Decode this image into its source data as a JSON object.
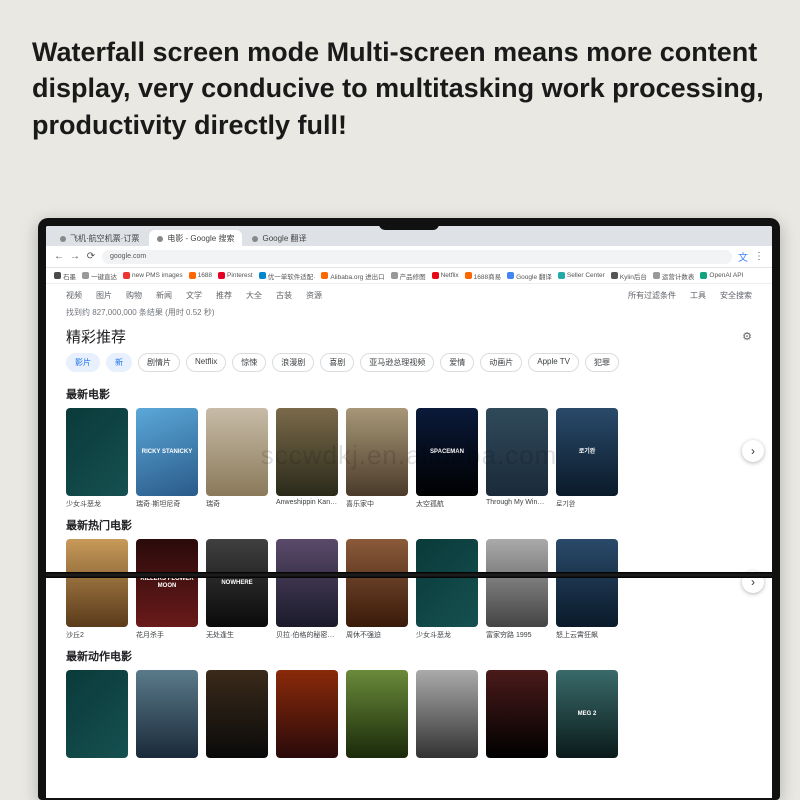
{
  "hero": "Waterfall screen mode Multi-screen means more content display, very conducive to multitasking work processing, productivity directly full!",
  "watermark": "sccwdkj.en.alibaba.com",
  "tabs": [
    {
      "label": "飞机·航空机票·订票",
      "active": false
    },
    {
      "label": "电影 - Google 搜索",
      "active": true
    },
    {
      "label": "Google 翻译",
      "active": false
    }
  ],
  "url": "google.com",
  "bookmarks": [
    {
      "label": "石墨",
      "color": "#4a4a4a"
    },
    {
      "label": "一键直达",
      "color": "#999"
    },
    {
      "label": "new PMS images",
      "color": "#e33"
    },
    {
      "label": "1688",
      "color": "#f60"
    },
    {
      "label": "Pinterest",
      "color": "#e60023"
    },
    {
      "label": "优一单软件适配·",
      "color": "#08c"
    },
    {
      "label": "Alibaba.org 进出口",
      "color": "#f60"
    },
    {
      "label": "产品修图",
      "color": "#999"
    },
    {
      "label": "Netflix",
      "color": "#e50914"
    },
    {
      "label": "1688商易",
      "color": "#f60"
    },
    {
      "label": "Google 翻译",
      "color": "#4285f4"
    },
    {
      "label": "Seller Center",
      "color": "#2aa"
    },
    {
      "label": "Kylin后台",
      "color": "#555"
    },
    {
      "label": "运营计数表",
      "color": "#999"
    },
    {
      "label": "OpenAI API",
      "color": "#10a37f"
    }
  ],
  "gnav": {
    "items": [
      "视频",
      "图片",
      "购物",
      "新闻",
      "文学",
      "推荐",
      "大全",
      "古装",
      "资源"
    ],
    "right1": "所有过滤条件",
    "right2": "工具",
    "right3": "安全搜索"
  },
  "results_meta": "找到约 827,000,000 条结果 (用时 0.52 秒)",
  "feature_title": "精彩推荐",
  "chips": [
    {
      "label": "影片",
      "blue": true
    },
    {
      "label": "新",
      "blue": true
    },
    {
      "label": "剧情片",
      "blue": false
    },
    {
      "label": "Netflix",
      "blue": false
    },
    {
      "label": "惊悚",
      "blue": false
    },
    {
      "label": "浪漫剧",
      "blue": false
    },
    {
      "label": "喜剧",
      "blue": false
    },
    {
      "label": "亚马逊总理视频",
      "blue": false
    },
    {
      "label": "爱情",
      "blue": false
    },
    {
      "label": "动画片",
      "blue": false
    },
    {
      "label": "Apple TV",
      "blue": false
    },
    {
      "label": "犯罪",
      "blue": false
    }
  ],
  "sections": [
    {
      "head": "最新电影",
      "items": [
        {
          "title": "少女斗恶龙",
          "bg": "linear-gradient(135deg,#0a3a3a,#165050)"
        },
        {
          "title": "瑞奇·斯坦尼奇",
          "bg": "linear-gradient(160deg,#5aa8d8,#2a5a8a)",
          "label": "RICKY STANICKY"
        },
        {
          "title": "瑞奇",
          "bg": "linear-gradient(#c8bca8,#8a7a5a)"
        },
        {
          "title": "Anweshippin Kan…",
          "bg": "linear-gradient(#7a6a4a,#2a2a1a)"
        },
        {
          "title": "喜乐家中",
          "bg": "linear-gradient(#a89878,#4a3a2a)"
        },
        {
          "title": "太空孤航",
          "bg": "linear-gradient(#0a1a3a,#000)",
          "label": "SPACEMAN"
        },
        {
          "title": "Through My Win…",
          "bg": "linear-gradient(#304a5a,#1a2a3a)"
        },
        {
          "title": "로기완",
          "bg": "linear-gradient(#2a4a6a,#0a1a2a)",
          "label": "로기완"
        }
      ]
    },
    {
      "head": "最新热门电影",
      "items": [
        {
          "title": "沙丘2",
          "bg": "linear-gradient(#c89a5a,#5a3a1a)"
        },
        {
          "title": "花月杀手",
          "bg": "linear-gradient(#2a0a0a,#6a1a1a)",
          "label": "KILLERS FLOWER MOON"
        },
        {
          "title": "无处逢生",
          "bg": "linear-gradient(#404040,#0a0a0a)",
          "label": "NOWHERE"
        },
        {
          "title": "贝拉·伯格的秘密生…",
          "bg": "linear-gradient(#5a4a6a,#1a1a2a)"
        },
        {
          "title": "周休不强迫",
          "bg": "linear-gradient(#8a5a3a,#3a1a0a)"
        },
        {
          "title": "少女斗恶龙",
          "bg": "linear-gradient(135deg,#0a3a3a,#165050)"
        },
        {
          "title": "富家穷路 1995",
          "bg": "linear-gradient(#aaa,#444)"
        },
        {
          "title": "怒上云霄狂飙",
          "bg": "linear-gradient(#2a4a6a,#0a1a2a)"
        }
      ]
    },
    {
      "head": "最新动作电影",
      "items": [
        {
          "title": "",
          "bg": "linear-gradient(135deg,#0a3a3a,#165050)"
        },
        {
          "title": "",
          "bg": "linear-gradient(#5a7a8a,#1a2a3a)"
        },
        {
          "title": "",
          "bg": "linear-gradient(#3a2a1a,#0a0a0a)"
        },
        {
          "title": "",
          "bg": "linear-gradient(#8a2a0a,#2a0a0a)"
        },
        {
          "title": "",
          "bg": "linear-gradient(#6a8a3a,#1a2a0a)"
        },
        {
          "title": "",
          "bg": "linear-gradient(#aaa,#333)"
        },
        {
          "title": "",
          "bg": "linear-gradient(#4a1a1a,#000)"
        },
        {
          "title": "",
          "bg": "linear-gradient(#3a6a6a,#0a1a1a)",
          "label": "MEG 2"
        }
      ]
    }
  ],
  "arrow_glyph": "›"
}
